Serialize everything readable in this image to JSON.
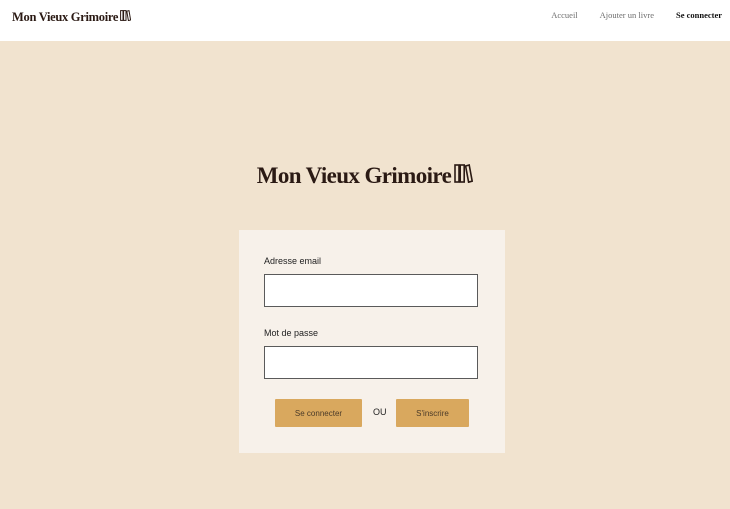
{
  "header": {
    "brand": "Mon Vieux Grimoire",
    "brand_icon": "books-icon",
    "nav": [
      {
        "label": "Accueil"
      },
      {
        "label": "Ajouter un livre"
      },
      {
        "label": "Se connecter",
        "active": true
      }
    ]
  },
  "hero": {
    "brand": "Mon Vieux Grimoire",
    "brand_icon": "books-icon"
  },
  "login": {
    "email_label": "Adresse email",
    "email_value": "",
    "password_label": "Mot de passe",
    "password_value": "",
    "login_button": "Se connecter",
    "or_text": "OU",
    "signup_button": "S'inscrire"
  },
  "colors": {
    "background": "#f1e3cf",
    "card": "#f7f1ea",
    "accent": "#d9a85e",
    "brand_text": "#2b1a14"
  }
}
